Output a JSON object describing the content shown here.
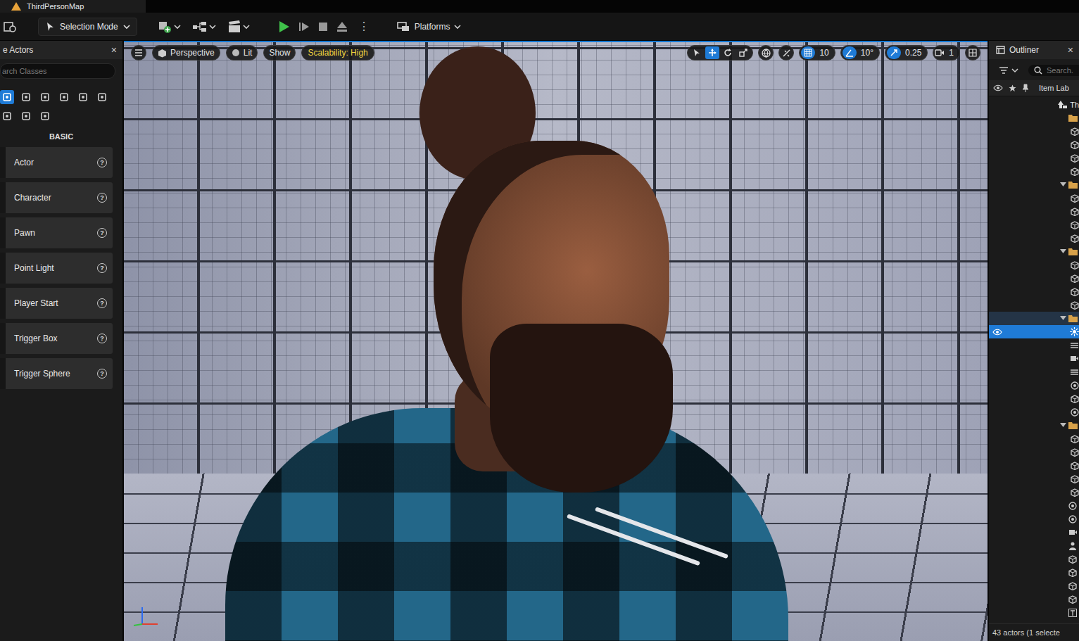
{
  "window": {
    "title": "ThirdPersonMap"
  },
  "toolbar": {
    "mode_button": "Selection Mode",
    "more": "⋮",
    "platforms": "Platforms"
  },
  "place_actors": {
    "tab": "e Actors",
    "close": "×",
    "search_placeholder": "arch Classes",
    "category": "BASIC",
    "help": "?",
    "modes": [
      {
        "selected": true
      },
      {
        "selected": false
      },
      {
        "selected": false
      },
      {
        "selected": false
      },
      {
        "selected": false
      },
      {
        "selected": false
      },
      {
        "selected": false
      },
      {
        "selected": false
      },
      {
        "selected": false
      }
    ],
    "items": [
      {
        "label": "Actor"
      },
      {
        "label": "Character"
      },
      {
        "label": "Pawn"
      },
      {
        "label": "Point Light"
      },
      {
        "label": "Player Start"
      },
      {
        "label": "Trigger Box"
      },
      {
        "label": "Trigger Sphere"
      }
    ]
  },
  "viewport": {
    "view_mode": "Perspective",
    "lighting": "Lit",
    "show": "Show",
    "scalability": "Scalability: High",
    "transform_tools": [
      {
        "tool": "select",
        "selected": false
      },
      {
        "tool": "translate",
        "selected": true
      },
      {
        "tool": "rotate",
        "selected": false
      },
      {
        "tool": "scale",
        "selected": false
      }
    ],
    "grid_snap": {
      "value": "10",
      "on": true
    },
    "angle_snap": {
      "value": "10°",
      "on": true
    },
    "scale_snap": {
      "value": "0.25",
      "on": true
    },
    "camera_speed": "1"
  },
  "outliner": {
    "title": "Outliner",
    "close": "×",
    "search_placeholder": "Search.",
    "column": "Item Lab",
    "footer": "43 actors (1 selecte",
    "rows": [
      {
        "kind": "level",
        "depth": 0,
        "label": "Th",
        "selected": false,
        "highlighted": false
      },
      {
        "kind": "folder",
        "depth": 1,
        "expanded": false,
        "selected": false,
        "highlighted": false
      },
      {
        "kind": "mesh",
        "depth": 2,
        "selected": false,
        "highlighted": false
      },
      {
        "kind": "mesh",
        "depth": 2,
        "selected": false,
        "highlighted": false
      },
      {
        "kind": "mesh",
        "depth": 2,
        "selected": false,
        "highlighted": false
      },
      {
        "kind": "mesh",
        "depth": 2,
        "selected": false,
        "highlighted": false
      },
      {
        "kind": "folder",
        "depth": 1,
        "expanded": true,
        "selected": false,
        "highlighted": false
      },
      {
        "kind": "mesh",
        "depth": 2,
        "selected": false,
        "highlighted": false
      },
      {
        "kind": "mesh",
        "depth": 2,
        "selected": false,
        "highlighted": false
      },
      {
        "kind": "mesh",
        "depth": 2,
        "selected": false,
        "highlighted": false
      },
      {
        "kind": "mesh",
        "depth": 2,
        "selected": false,
        "highlighted": false
      },
      {
        "kind": "folder",
        "depth": 1,
        "expanded": true,
        "selected": false,
        "highlighted": false
      },
      {
        "kind": "mesh",
        "depth": 2,
        "selected": false,
        "highlighted": false
      },
      {
        "kind": "mesh",
        "depth": 2,
        "selected": false,
        "highlighted": false
      },
      {
        "kind": "mesh",
        "depth": 2,
        "selected": false,
        "highlighted": false
      },
      {
        "kind": "mesh",
        "depth": 2,
        "selected": false,
        "highlighted": false
      },
      {
        "kind": "folder",
        "depth": 1,
        "expanded": true,
        "selected": false,
        "highlighted": true
      },
      {
        "kind": "light",
        "depth": 2,
        "selected": true,
        "highlighted": false
      },
      {
        "kind": "fog",
        "depth": 2,
        "selected": false,
        "highlighted": false
      },
      {
        "kind": "camera",
        "depth": 2,
        "selected": false,
        "highlighted": false
      },
      {
        "kind": "fog",
        "depth": 2,
        "selected": false,
        "highlighted": false
      },
      {
        "kind": "sphere",
        "depth": 2,
        "selected": false,
        "highlighted": false
      },
      {
        "kind": "mesh",
        "depth": 2,
        "selected": false,
        "highlighted": false
      },
      {
        "kind": "sphere",
        "depth": 2,
        "selected": false,
        "highlighted": false
      },
      {
        "kind": "folder",
        "depth": 1,
        "expanded": true,
        "selected": false,
        "highlighted": false
      },
      {
        "kind": "mesh",
        "depth": 2,
        "selected": false,
        "highlighted": false
      },
      {
        "kind": "mesh",
        "depth": 2,
        "selected": false,
        "highlighted": false
      },
      {
        "kind": "mesh",
        "depth": 2,
        "selected": false,
        "highlighted": false
      },
      {
        "kind": "mesh",
        "depth": 2,
        "selected": false,
        "highlighted": false
      },
      {
        "kind": "mesh",
        "depth": 2,
        "selected": false,
        "highlighted": false
      },
      {
        "kind": "sphere",
        "depth": 1,
        "selected": false,
        "highlighted": false
      },
      {
        "kind": "sphere",
        "depth": 1,
        "selected": false,
        "highlighted": false
      },
      {
        "kind": "camera",
        "depth": 1,
        "selected": false,
        "highlighted": false
      },
      {
        "kind": "player",
        "depth": 1,
        "selected": false,
        "highlighted": false
      },
      {
        "kind": "mesh",
        "depth": 1,
        "selected": false,
        "highlighted": false
      },
      {
        "kind": "mesh",
        "depth": 1,
        "selected": false,
        "highlighted": false
      },
      {
        "kind": "mesh",
        "depth": 1,
        "selected": false,
        "highlighted": false
      },
      {
        "kind": "mesh",
        "depth": 1,
        "selected": false,
        "highlighted": false
      },
      {
        "kind": "text",
        "depth": 1,
        "selected": false,
        "highlighted": false
      }
    ]
  }
}
